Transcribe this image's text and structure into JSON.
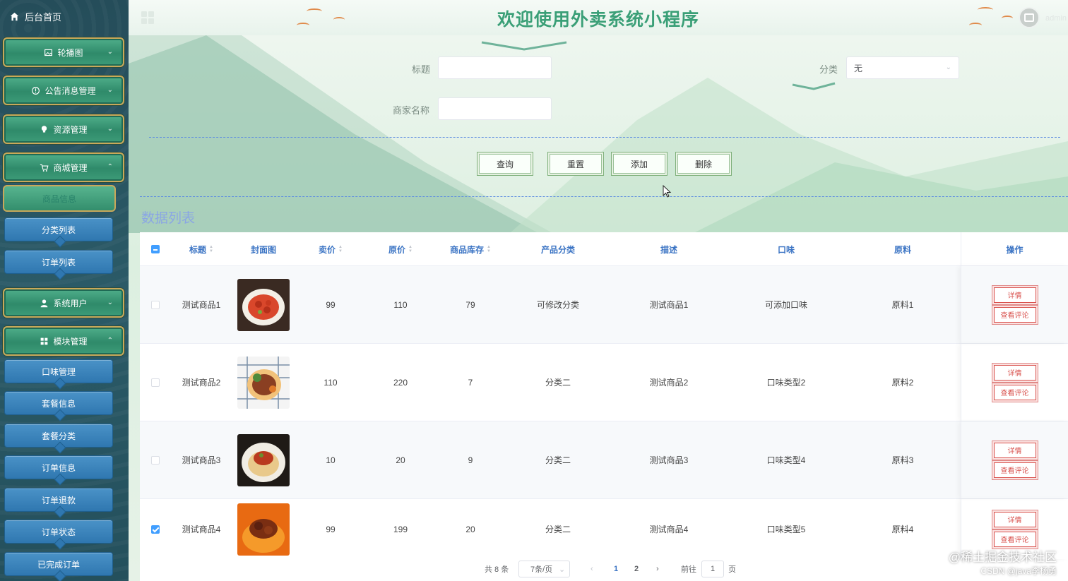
{
  "sidebar": {
    "home_label": "后台首页",
    "groups": [
      {
        "label": "轮播图"
      },
      {
        "label": "公告消息管理"
      },
      {
        "label": "资源管理"
      },
      {
        "label": "商城管理"
      },
      {
        "label": "系统用户"
      },
      {
        "label": "模块管理"
      }
    ],
    "active_sub": "商品信息",
    "items": [
      "分类列表",
      "订单列表",
      "口味管理",
      "套餐信息",
      "套餐分类",
      "订单信息",
      "订单退款",
      "订单状态",
      "已完成订单"
    ]
  },
  "header": {
    "title": "欢迎使用外卖系统小程序",
    "user": "admin"
  },
  "search": {
    "title_label": "标题",
    "title_value": "",
    "category_label": "分类",
    "category_value": "无",
    "merchant_label": "商家名称",
    "merchant_value": "",
    "buttons": {
      "query": "查询",
      "reset": "重置",
      "add": "添加",
      "delete": "删除"
    }
  },
  "list_title": "数据列表",
  "table": {
    "columns": [
      "标题",
      "封面图",
      "卖价",
      "原价",
      "商品库存",
      "产品分类",
      "描述",
      "口味",
      "原料",
      "操作"
    ],
    "rows": [
      {
        "title": "测试商品1",
        "price": "99",
        "original": "110",
        "stock": "79",
        "category": "可修改分类",
        "desc": "测试商品1",
        "flavor": "可添加口味",
        "material": "原料1",
        "checked": false
      },
      {
        "title": "测试商品2",
        "price": "110",
        "original": "220",
        "stock": "7",
        "category": "分类二",
        "desc": "测试商品2",
        "flavor": "口味类型2",
        "material": "原料2",
        "checked": false
      },
      {
        "title": "测试商品3",
        "price": "10",
        "original": "20",
        "stock": "9",
        "category": "分类二",
        "desc": "测试商品3",
        "flavor": "口味类型4",
        "material": "原料3",
        "checked": false
      },
      {
        "title": "测试商品4",
        "price": "99",
        "original": "199",
        "stock": "20",
        "category": "分类二",
        "desc": "测试商品4",
        "flavor": "口味类型5",
        "material": "原料4",
        "checked": true
      }
    ],
    "op_detail": "详情",
    "op_comment": "查看评论"
  },
  "pagination": {
    "total": "共 8 条",
    "page_size": "7条/页",
    "pages": [
      "1",
      "2"
    ],
    "current_page": "1",
    "goto_label": "前往",
    "goto_value": "1",
    "page_suffix": "页"
  },
  "watermark": {
    "line1": "@稀土掘金技术社区",
    "line2": "CSDN @java李杨勇"
  },
  "colors": {
    "title": "#3a9f77",
    "header_text": "#3b74c4",
    "danger": "#d9534f",
    "dash": "#5f8ee0"
  }
}
